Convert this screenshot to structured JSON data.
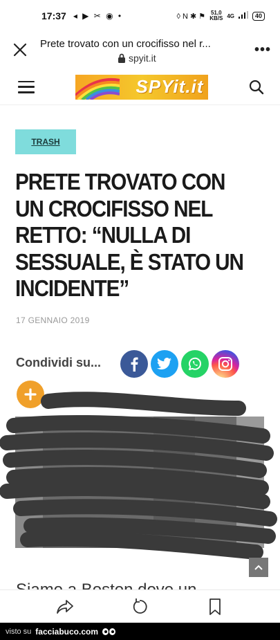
{
  "status_bar": {
    "time": "17:37",
    "left_icons": "◂ ▶ ✂ ◉ •",
    "right_icons": "◊ N ✱ ⚑",
    "net_speed_top": "51,0",
    "net_speed_bottom": "KB/S",
    "signal": "4G",
    "battery": "40"
  },
  "browser": {
    "page_title": "Prete trovato con un crocifisso nel r...",
    "url": "spyit.it"
  },
  "site": {
    "logo_text": "SPYit.it"
  },
  "article": {
    "tag": "TRASH",
    "headline_lines": [
      "PRETE TROVATO CON",
      "UN CROCIFISSO NEL",
      "RETTO: “NULLA DI",
      "SESSUALE, È STATO UN",
      "INCIDENTE”"
    ],
    "date": "17 GENNAIO 2019",
    "share_label": "Condividi su...",
    "next_text": "Siamo a Boston dove un"
  },
  "share_buttons": [
    {
      "name": "facebook",
      "icon": "facebook-icon",
      "color": "#3b5998"
    },
    {
      "name": "twitter",
      "icon": "twitter-icon",
      "color": "#1da1f2"
    },
    {
      "name": "whatsapp",
      "icon": "whatsapp-icon",
      "color": "#25d366"
    },
    {
      "name": "instagram",
      "icon": "instagram-icon"
    },
    {
      "name": "more",
      "icon": "plus-icon",
      "color": "#f0a02a"
    }
  ],
  "footer": {
    "prefix": "visto su",
    "brand": "facciabuco.com"
  }
}
